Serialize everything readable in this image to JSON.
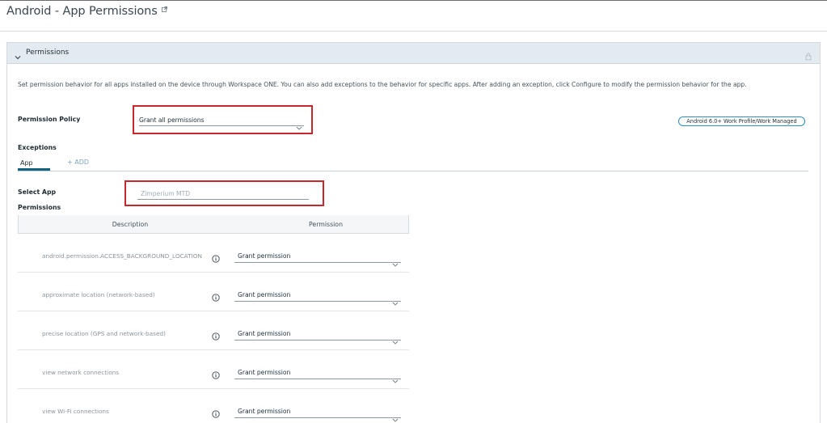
{
  "header": {
    "title": "Android - App Permissions",
    "external_icon": "external-link-icon"
  },
  "panel": {
    "title": "Permissions",
    "description": "Set permission behavior for all apps installed on the device through Workspace ONE. You can also add exceptions to the behavior for specific apps. After adding an exception, click Configure to modify the permission behavior for the app.",
    "permission_policy_label": "Permission Policy",
    "permission_policy_value": "Grant all permissions",
    "badge": "Android 6.0+ Work Profile/Work Managed",
    "exceptions_label": "Exceptions",
    "tabs": [
      {
        "label": "App"
      }
    ],
    "add_label": "+ ADD",
    "select_app_label": "Select App",
    "select_app_placeholder": "Zimperium MTD",
    "permissions_label": "Permissions"
  },
  "table": {
    "columns": [
      "Description",
      "Permission"
    ],
    "rows": [
      {
        "description": "android.permission.ACCESS_BACKGROUND_LOCATION",
        "permission": "Grant permission"
      },
      {
        "description": "approximate location (network-based)",
        "permission": "Grant permission"
      },
      {
        "description": "precise location (GPS and network-based)",
        "permission": "Grant permission"
      },
      {
        "description": "view network connections",
        "permission": "Grant permission"
      },
      {
        "description": "view Wi-Fi connections",
        "permission": "Grant permission"
      }
    ]
  },
  "colors": {
    "highlight": "#c8262d",
    "accent": "#15627c",
    "header_bg": "#e4ebf0",
    "badge_border": "#2f8fbf"
  }
}
